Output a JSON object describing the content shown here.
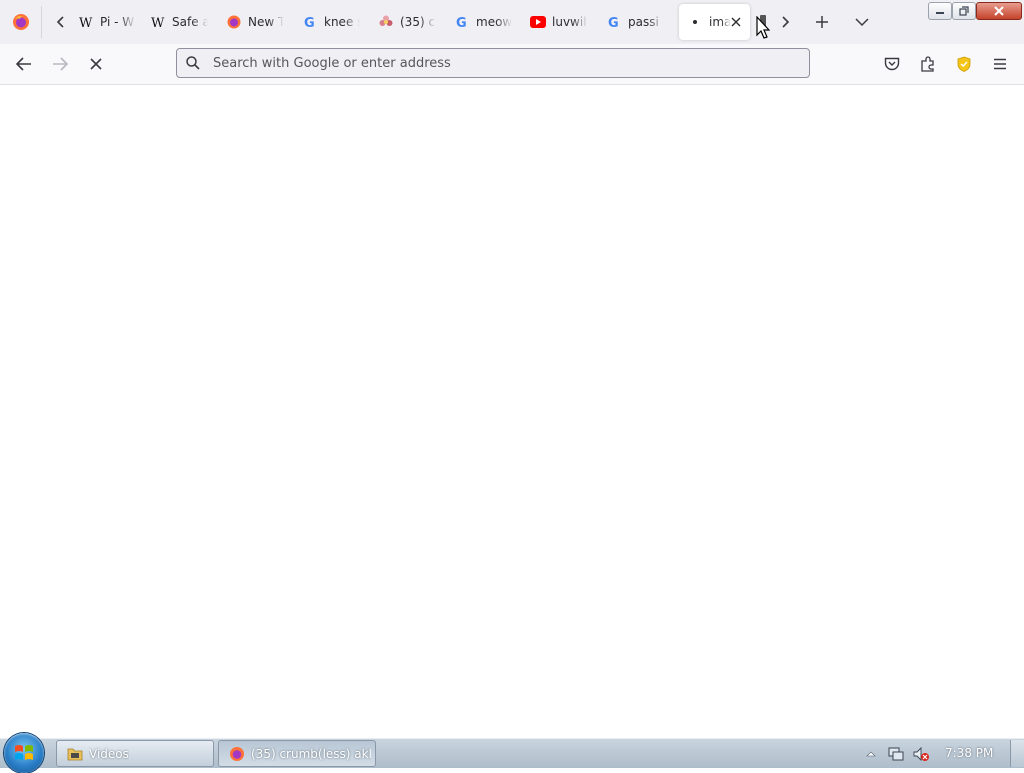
{
  "browser": {
    "tabs": [
      {
        "title": "Pi - W",
        "favicon": "wikipedia-icon",
        "active": false
      },
      {
        "title": "Safe a",
        "favicon": "wikipedia-icon",
        "active": false
      },
      {
        "title": "New T",
        "favicon": "firefox-icon",
        "active": false
      },
      {
        "title": "knee s",
        "favicon": "google-icon",
        "active": false
      },
      {
        "title": "(35) c",
        "favicon": "flower-icon",
        "active": false
      },
      {
        "title": "meow",
        "favicon": "google-icon",
        "active": false
      },
      {
        "title": "luvwil",
        "favicon": "youtube-icon",
        "active": false
      },
      {
        "title": "passi",
        "favicon": "google-icon",
        "active": false
      },
      {
        "title": "ima",
        "favicon": "loading-dot-icon",
        "active": true
      }
    ],
    "address_bar": {
      "value": "",
      "placeholder": "Search with Google or enter address"
    }
  },
  "taskbar": {
    "items": [
      {
        "label": "Videos",
        "icon": "folder-icon"
      },
      {
        "label": "(35) crumb(less) akk...",
        "icon": "firefox-icon"
      }
    ],
    "clock": "7:38 PM"
  },
  "colors": {
    "tabstrip_bg": "#f0f0f4",
    "navbar_bg": "#f9f9fb",
    "urlbar_bg": "#f0f0f4",
    "shield_yellow": "#f5c518",
    "youtube_red": "#ff0000"
  }
}
